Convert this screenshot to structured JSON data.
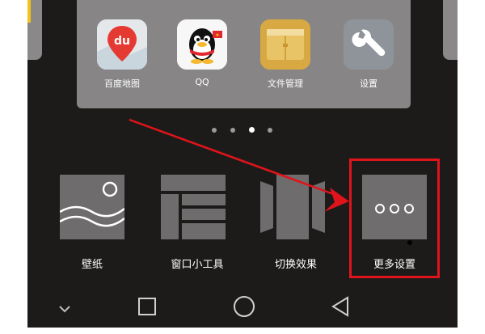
{
  "dock": {
    "apps": [
      {
        "label": "百度地图",
        "icon": "baidu-map-icon"
      },
      {
        "label": "QQ",
        "icon": "qq-penguin-icon"
      },
      {
        "label": "文件管理",
        "icon": "folder-icon"
      },
      {
        "label": "设置",
        "icon": "wrench-icon"
      }
    ]
  },
  "pager": {
    "count": 4,
    "active_index": 2
  },
  "options": [
    {
      "label": "壁纸",
      "icon": "wallpaper-icon"
    },
    {
      "label": "窗口小工具",
      "icon": "widgets-icon"
    },
    {
      "label": "切换效果",
      "icon": "transition-effect-icon"
    },
    {
      "label": "更多设置",
      "icon": "more-icon"
    }
  ],
  "navbar": {
    "items": [
      {
        "icon": "chevron-down-icon"
      },
      {
        "icon": "recents-square-icon"
      },
      {
        "icon": "home-circle-icon"
      },
      {
        "icon": "back-triangle-icon"
      }
    ]
  },
  "annotation": {
    "color": "#e0141b",
    "target": "更多设置"
  },
  "colors": {
    "screen_bg": "#1d1b1a",
    "panel_bg": "#878585",
    "text": "#ffffff"
  }
}
